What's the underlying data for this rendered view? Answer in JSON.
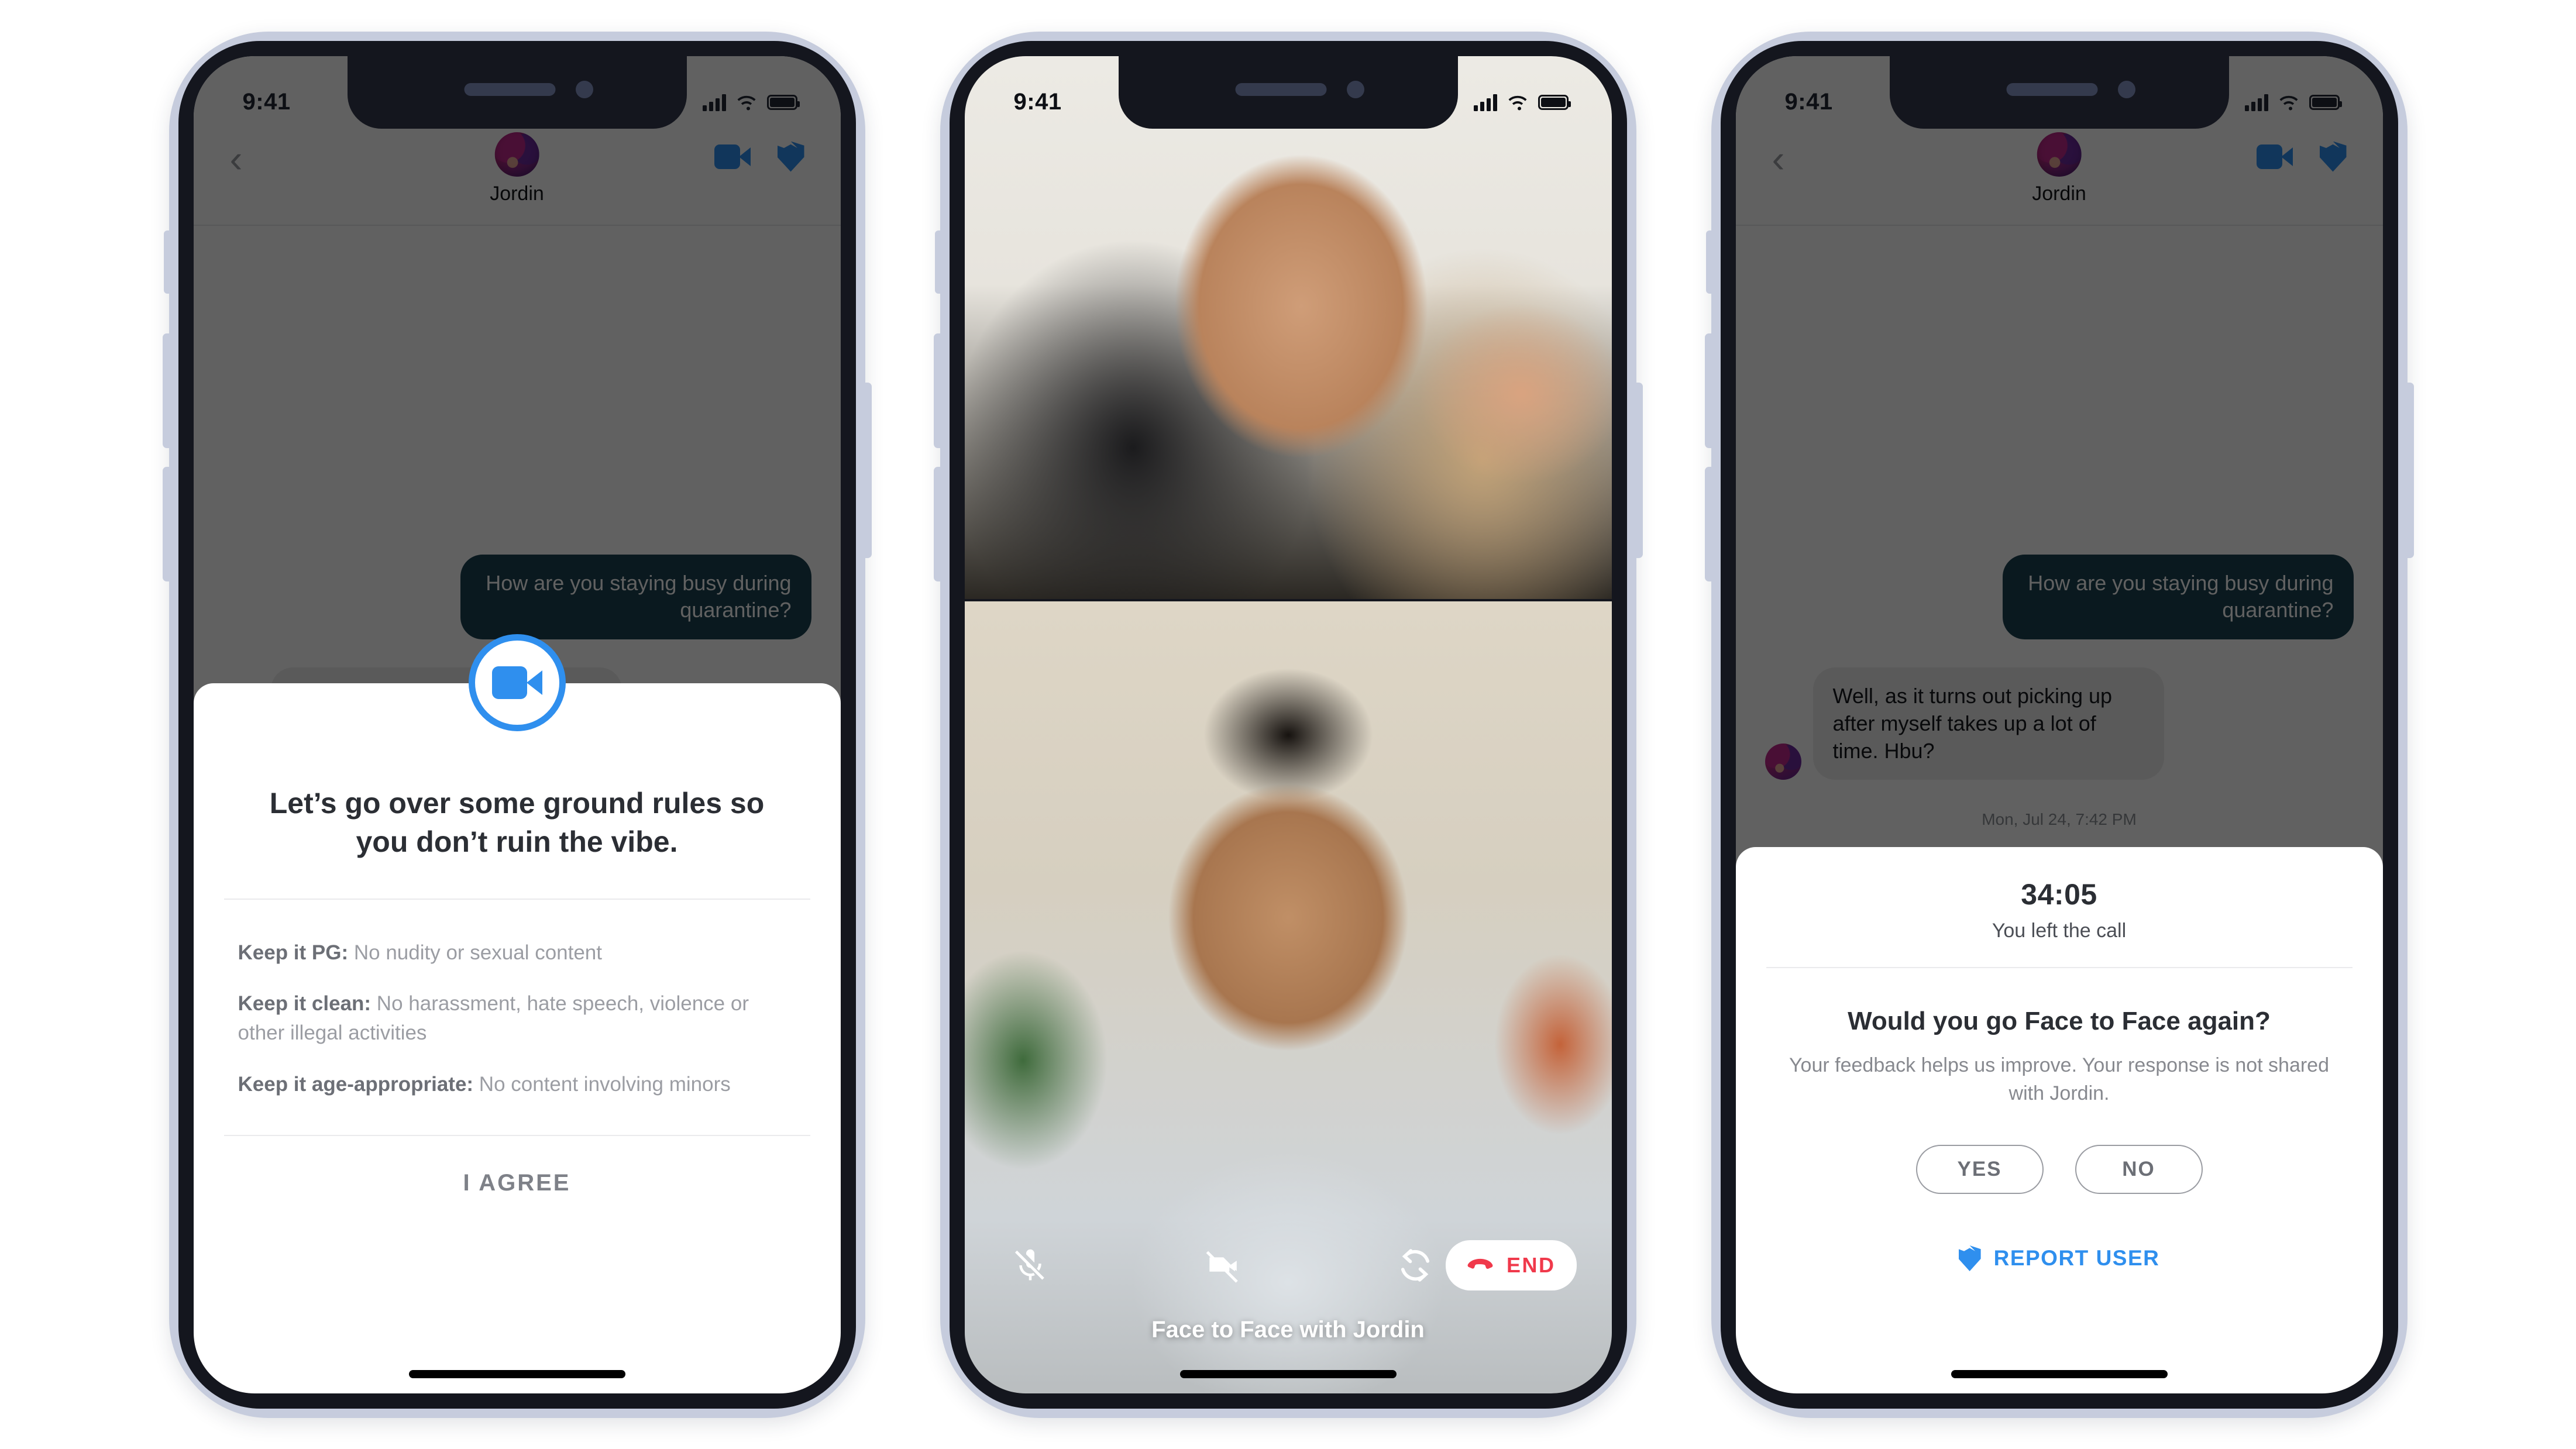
{
  "status_bar": {
    "time": "9:41",
    "signal_icon": "signal-bars-icon",
    "wifi_icon": "wifi-icon",
    "battery_icon": "battery-icon"
  },
  "colors": {
    "accent_blue": "#2f8fee",
    "bubble_outgoing": "#1b4352",
    "bubble_incoming": "#ececec",
    "danger_red": "#f0394b",
    "phone_rim": "#c6ccdd",
    "phone_frame": "#2c3040"
  },
  "chat": {
    "back_icon": "chevron-left-icon",
    "peer_name": "Jordin",
    "avatar_icon": "avatar",
    "video_icon": "video-camera-icon",
    "shield_icon": "shield-icon",
    "messages": [
      {
        "direction": "outgoing",
        "text": "How are you staying busy during quarantine?"
      },
      {
        "direction": "incoming",
        "text": "Well, as it turns out picking up after myself takes up a lot of time. Hbu?"
      }
    ],
    "timestamp": "Mon, Jul 24, 7:42 PM"
  },
  "rules_sheet": {
    "badge_icon": "video-camera-icon",
    "title": "Let’s go over some ground rules so you don’t ruin the vibe.",
    "rules": [
      {
        "label": "Keep it PG:",
        "text": " No nudity or sexual content"
      },
      {
        "label": "Keep it clean:",
        "text": " No harassment, hate speech, violence or other illegal activities"
      },
      {
        "label": "Keep it age-appropriate:",
        "text": " No content involving minors"
      }
    ],
    "agree_label": "I AGREE"
  },
  "call_screen": {
    "mute_icon": "microphone-muted-icon",
    "camera_off_icon": "camera-off-icon",
    "flip_camera_icon": "camera-flip-icon",
    "end_icon": "phone-hangup-icon",
    "end_label": "END",
    "title": "Face to Face with Jordin"
  },
  "recap_sheet": {
    "timer": "34:05",
    "subtitle": "You left the call",
    "question": "Would you go Face to Face again?",
    "note": "Your feedback helps us improve. Your response is not shared with Jordin.",
    "yes_label": "YES",
    "no_label": "NO",
    "report_icon": "shield-icon",
    "report_label": "REPORT USER"
  }
}
